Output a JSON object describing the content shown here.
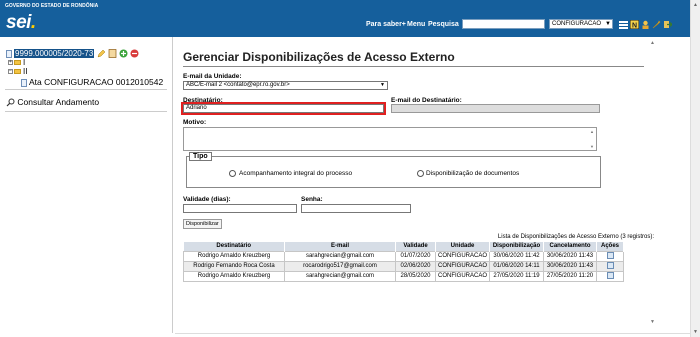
{
  "header": {
    "gov_text": "GOVERNO DO ESTADO DE RONDÔNIA",
    "logo": "sei",
    "logo_dot": ".",
    "links": [
      "Para saber+",
      "Menu",
      "Pesquisa"
    ],
    "search_value": "",
    "unit_value": "CONFIGURACAO",
    "icons": [
      "view-toggle-icon",
      "notepad-icon",
      "user-icon",
      "settings-icon",
      "exit-icon"
    ],
    "bg_color": "#155f9c"
  },
  "tree": {
    "process_number": "9999.000005/2020-73",
    "process_icons": [
      "pencil-icon",
      "document-icon",
      "plus-icon",
      "remove-icon"
    ],
    "folder1": "I",
    "folder2": "II",
    "document": "Ata CONFIGURACAO 0012010542",
    "consult": "Consultar Andamento"
  },
  "main": {
    "title": "Gerenciar Disponibilizações de Acesso Externo",
    "email_unit_label": "E-mail da Unidade:",
    "email_unit_value": "ABC/E-mail 2 <contato@epr.ro.gov.br>",
    "recipient_label": "Destinatário:",
    "recipient_value": "Adriano",
    "recipient_email_label": "E-mail do Destinatário:",
    "recipient_email_value": "",
    "reason_label": "Motivo:",
    "reason_value": "",
    "type_legend": "Tipo",
    "type_opt1": "Acompanhamento integral do processo",
    "type_opt2": "Disponibilização de documentos",
    "validity_label": "Validade (dias):",
    "validity_value": "",
    "password_label": "Senha:",
    "password_value": "",
    "submit_label": "Disponibilizar",
    "table_caption": "Lista de Disponibilizações de Acesso Externo (3 registros):",
    "columns": [
      "Destinatário",
      "E-mail",
      "Validade",
      "Unidade",
      "Disponibilização",
      "Cancelamento",
      "Ações"
    ],
    "rows": [
      [
        "Rodrigo Arnaldo Kreuzberg",
        "sarahgrecian@gmail.com",
        "01/07/2020",
        "CONFIGURACAO",
        "30/06/2020 11:42",
        "30/06/2020 11:43"
      ],
      [
        "Rodrigo Fernando Roca Costa",
        "rocarodrigo517@gmail.com",
        "02/06/2020",
        "CONFIGURACAO",
        "01/06/2020 14:11",
        "30/06/2020 11:43"
      ],
      [
        "Rodrigo Arnaldo Kreuzberg",
        "sarahgrecian@gmail.com",
        "28/05/2020",
        "CONFIGURACAO",
        "27/05/2020 11:19",
        "27/05/2020 11:20"
      ]
    ],
    "row_action_icon": "view-icon",
    "highlight_color": "#e02020"
  }
}
